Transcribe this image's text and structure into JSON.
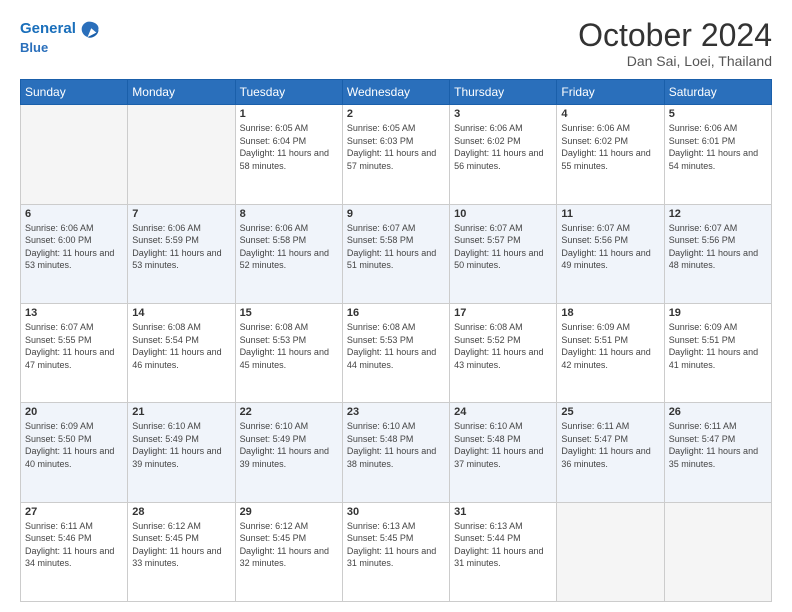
{
  "header": {
    "logo_line1": "General",
    "logo_line2": "Blue",
    "month": "October 2024",
    "location": "Dan Sai, Loei, Thailand"
  },
  "weekdays": [
    "Sunday",
    "Monday",
    "Tuesday",
    "Wednesday",
    "Thursday",
    "Friday",
    "Saturday"
  ],
  "weeks": [
    [
      {
        "day": "",
        "empty": true
      },
      {
        "day": "",
        "empty": true
      },
      {
        "day": "1",
        "sunrise": "6:05 AM",
        "sunset": "6:04 PM",
        "daylight": "11 hours and 58 minutes."
      },
      {
        "day": "2",
        "sunrise": "6:05 AM",
        "sunset": "6:03 PM",
        "daylight": "11 hours and 57 minutes."
      },
      {
        "day": "3",
        "sunrise": "6:06 AM",
        "sunset": "6:02 PM",
        "daylight": "11 hours and 56 minutes."
      },
      {
        "day": "4",
        "sunrise": "6:06 AM",
        "sunset": "6:02 PM",
        "daylight": "11 hours and 55 minutes."
      },
      {
        "day": "5",
        "sunrise": "6:06 AM",
        "sunset": "6:01 PM",
        "daylight": "11 hours and 54 minutes."
      }
    ],
    [
      {
        "day": "6",
        "sunrise": "6:06 AM",
        "sunset": "6:00 PM",
        "daylight": "11 hours and 53 minutes."
      },
      {
        "day": "7",
        "sunrise": "6:06 AM",
        "sunset": "5:59 PM",
        "daylight": "11 hours and 53 minutes."
      },
      {
        "day": "8",
        "sunrise": "6:06 AM",
        "sunset": "5:58 PM",
        "daylight": "11 hours and 52 minutes."
      },
      {
        "day": "9",
        "sunrise": "6:07 AM",
        "sunset": "5:58 PM",
        "daylight": "11 hours and 51 minutes."
      },
      {
        "day": "10",
        "sunrise": "6:07 AM",
        "sunset": "5:57 PM",
        "daylight": "11 hours and 50 minutes."
      },
      {
        "day": "11",
        "sunrise": "6:07 AM",
        "sunset": "5:56 PM",
        "daylight": "11 hours and 49 minutes."
      },
      {
        "day": "12",
        "sunrise": "6:07 AM",
        "sunset": "5:56 PM",
        "daylight": "11 hours and 48 minutes."
      }
    ],
    [
      {
        "day": "13",
        "sunrise": "6:07 AM",
        "sunset": "5:55 PM",
        "daylight": "11 hours and 47 minutes."
      },
      {
        "day": "14",
        "sunrise": "6:08 AM",
        "sunset": "5:54 PM",
        "daylight": "11 hours and 46 minutes."
      },
      {
        "day": "15",
        "sunrise": "6:08 AM",
        "sunset": "5:53 PM",
        "daylight": "11 hours and 45 minutes."
      },
      {
        "day": "16",
        "sunrise": "6:08 AM",
        "sunset": "5:53 PM",
        "daylight": "11 hours and 44 minutes."
      },
      {
        "day": "17",
        "sunrise": "6:08 AM",
        "sunset": "5:52 PM",
        "daylight": "11 hours and 43 minutes."
      },
      {
        "day": "18",
        "sunrise": "6:09 AM",
        "sunset": "5:51 PM",
        "daylight": "11 hours and 42 minutes."
      },
      {
        "day": "19",
        "sunrise": "6:09 AM",
        "sunset": "5:51 PM",
        "daylight": "11 hours and 41 minutes."
      }
    ],
    [
      {
        "day": "20",
        "sunrise": "6:09 AM",
        "sunset": "5:50 PM",
        "daylight": "11 hours and 40 minutes."
      },
      {
        "day": "21",
        "sunrise": "6:10 AM",
        "sunset": "5:49 PM",
        "daylight": "11 hours and 39 minutes."
      },
      {
        "day": "22",
        "sunrise": "6:10 AM",
        "sunset": "5:49 PM",
        "daylight": "11 hours and 39 minutes."
      },
      {
        "day": "23",
        "sunrise": "6:10 AM",
        "sunset": "5:48 PM",
        "daylight": "11 hours and 38 minutes."
      },
      {
        "day": "24",
        "sunrise": "6:10 AM",
        "sunset": "5:48 PM",
        "daylight": "11 hours and 37 minutes."
      },
      {
        "day": "25",
        "sunrise": "6:11 AM",
        "sunset": "5:47 PM",
        "daylight": "11 hours and 36 minutes."
      },
      {
        "day": "26",
        "sunrise": "6:11 AM",
        "sunset": "5:47 PM",
        "daylight": "11 hours and 35 minutes."
      }
    ],
    [
      {
        "day": "27",
        "sunrise": "6:11 AM",
        "sunset": "5:46 PM",
        "daylight": "11 hours and 34 minutes."
      },
      {
        "day": "28",
        "sunrise": "6:12 AM",
        "sunset": "5:45 PM",
        "daylight": "11 hours and 33 minutes."
      },
      {
        "day": "29",
        "sunrise": "6:12 AM",
        "sunset": "5:45 PM",
        "daylight": "11 hours and 32 minutes."
      },
      {
        "day": "30",
        "sunrise": "6:13 AM",
        "sunset": "5:45 PM",
        "daylight": "11 hours and 31 minutes."
      },
      {
        "day": "31",
        "sunrise": "6:13 AM",
        "sunset": "5:44 PM",
        "daylight": "11 hours and 31 minutes."
      },
      {
        "day": "",
        "empty": true
      },
      {
        "day": "",
        "empty": true
      }
    ]
  ],
  "labels": {
    "sunrise": "Sunrise:",
    "sunset": "Sunset:",
    "daylight": "Daylight:"
  }
}
